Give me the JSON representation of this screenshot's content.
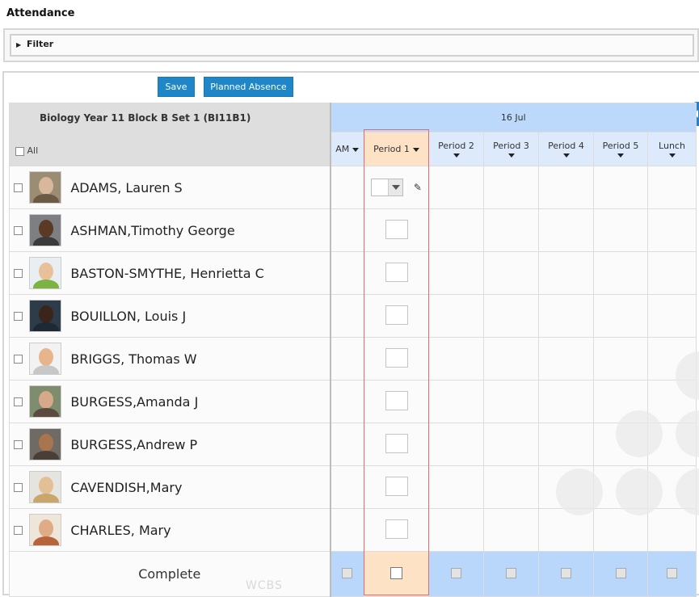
{
  "page": {
    "title": "Attendance"
  },
  "filter": {
    "label": "Filter"
  },
  "toolbar": {
    "save_label": "Save",
    "planned_absence_label": "Planned Absence"
  },
  "register": {
    "class_title": "Biology Year 11 Block B Set 1 (BI11B1)",
    "all_label": "All",
    "date": "16 Jul",
    "periods": [
      "AM",
      "Period 1",
      "Period 2",
      "Period 3",
      "Period 4",
      "Period 5",
      "Lunch"
    ],
    "active_period": "Period 1",
    "complete_label": "Complete"
  },
  "students": [
    {
      "name": "ADAMS, Lauren S"
    },
    {
      "name": "ASHMAN,Timothy George"
    },
    {
      "name": "BASTON-SMYTHE, Henrietta C"
    },
    {
      "name": "BOUILLON, Louis J"
    },
    {
      "name": "BRIGGS, Thomas W"
    },
    {
      "name": "BURGESS,Amanda J"
    },
    {
      "name": "BURGESS,Andrew P"
    },
    {
      "name": "CAVENDISH,Mary"
    },
    {
      "name": "CHARLES, Mary"
    }
  ],
  "watermark": "WCBS",
  "colors": {
    "button": "#1f87c8",
    "date_header": "#bcd9fb",
    "period_header": "#dceafc",
    "active_period": "#fde2c6",
    "highlight_border": "#e26b6b"
  }
}
